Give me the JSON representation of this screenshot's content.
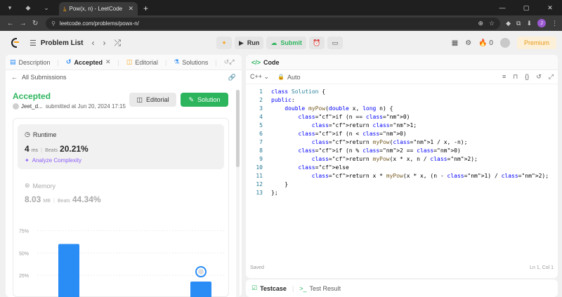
{
  "browser": {
    "tab_title": "Pow(x, n) - LeetCode",
    "url": "leetcode.com/problems/powx-n/"
  },
  "lc_nav": {
    "problem_list": "Problem List",
    "run": "Run",
    "submit": "Submit",
    "coins": "0",
    "premium": "Premium"
  },
  "left_tabs": {
    "description": "Description",
    "accepted": "Accepted",
    "editorial": "Editorial",
    "solutions": "Solutions"
  },
  "submission": {
    "all_submissions": "All Submissions",
    "status": "Accepted",
    "user": "Jeet_d...",
    "submitted_at": "submitted at Jun 20, 2024 17:15",
    "editorial_btn": "Editorial",
    "solution_btn": "Solution",
    "runtime_label": "Runtime",
    "runtime_value": "4",
    "runtime_unit": "ms",
    "beats_label": "Beats",
    "runtime_beats": "20.21%",
    "analyze": "Analyze Complexity",
    "memory_label": "Memory",
    "memory_value": "8.03",
    "memory_unit": "MB",
    "memory_beats": "44.34%"
  },
  "chart_data": {
    "type": "bar",
    "y_ticks": [
      "75%",
      "50%",
      "25%"
    ],
    "ylim": [
      0,
      80
    ],
    "bars": [
      {
        "x": 0,
        "value": 60,
        "color": "#2a8cf5"
      },
      {
        "x": 1,
        "value": 18,
        "color": "#2a8cf5"
      }
    ],
    "marker_bar": 1
  },
  "code_panel": {
    "title": "Code",
    "language": "C++",
    "mode": "Auto",
    "saved": "Saved",
    "cursor": "Ln 1, Col 1"
  },
  "code_lines": [
    "class Solution {",
    "public:",
    "    double myPow(double x, long n) {",
    "        if (n == 0)",
    "            return 1;",
    "        if (n < 0)",
    "            return myPow(1 / x, -n);",
    "        if (n % 2 == 0)",
    "            return myPow(x * x, n / 2);",
    "        else",
    "            return x * myPow(x * x, (n - 1) / 2);",
    "    }",
    "};"
  ],
  "bottom_panel": {
    "testcase": "Testcase",
    "test_result": "Test Result"
  }
}
